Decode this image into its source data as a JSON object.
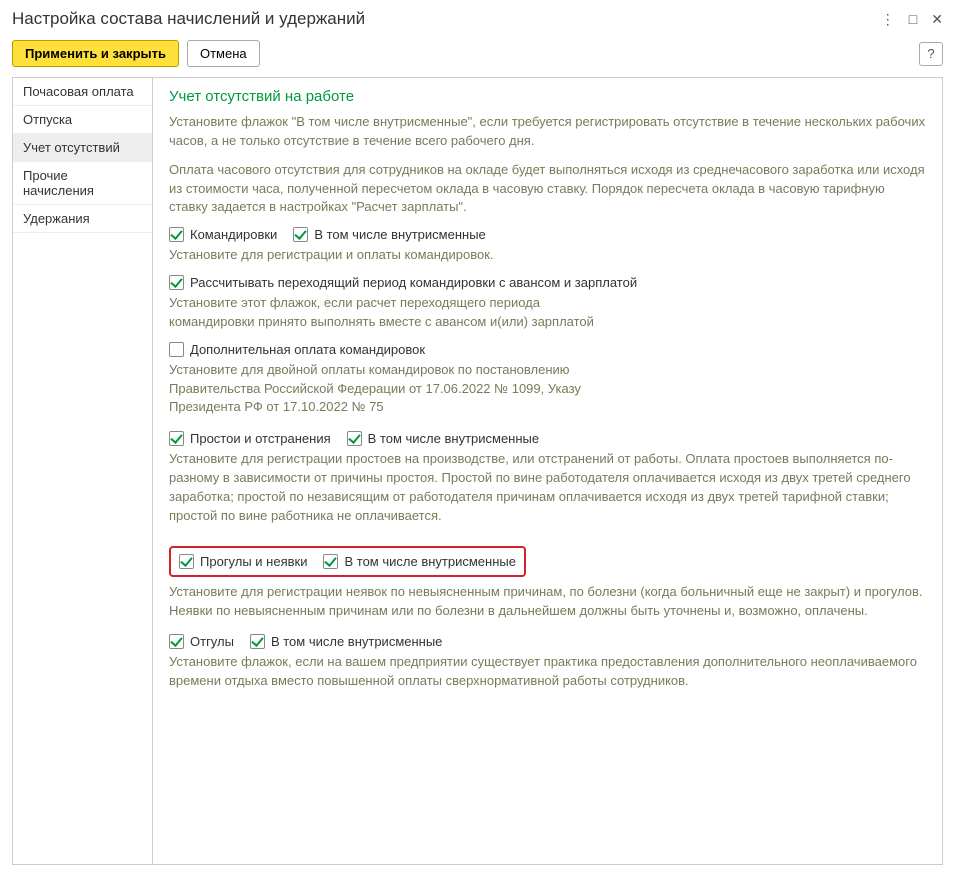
{
  "window": {
    "title": "Настройка состава начислений и удержаний"
  },
  "toolbar": {
    "apply_close": "Применить и закрыть",
    "cancel": "Отмена",
    "help": "?"
  },
  "sidebar": {
    "items": [
      {
        "label": "Почасовая оплата",
        "active": false
      },
      {
        "label": "Отпуска",
        "active": false
      },
      {
        "label": "Учет отсутствий",
        "active": true
      },
      {
        "label": "Прочие начисления",
        "active": false
      },
      {
        "label": "Удержания",
        "active": false
      }
    ]
  },
  "content": {
    "heading": "Учет отсутствий на работе",
    "intro1": "Установите флажок \"В том числе внутрисменные\", если требуется регистрировать отсутствие в течение нескольких рабочих часов, а не только отсутствие в течение всего рабочего дня.",
    "intro2": "Оплата часового отсутствия для сотрудников на окладе будет выполняться исходя из среднечасового заработка или исходя из стоимости часа, полученной пересчетом оклада в часовую ставку. Порядок пересчета оклада в часовую тарифную ставку задается в настройках \"Расчет зарплаты\".",
    "trips": {
      "label": "Командировки",
      "intra": "В том числе внутрисменные",
      "desc": "Установите для регистрации и оплаты командировок."
    },
    "tripsPeriod": {
      "label": "Рассчитывать переходящий период командировки с авансом и зарплатой",
      "desc": "Установите этот флажок, если расчет переходящего периода командировки принято выполнять вместе с авансом и(или) зарплатой"
    },
    "tripsExtra": {
      "label": "Дополнительная оплата командировок",
      "desc": "Установите для двойной оплаты командировок по постановлению Правительства Российской Федерации от 17.06.2022 № 1099, Указу Президента РФ от 17.10.2022 № 75"
    },
    "downtime": {
      "label": "Простои и отстранения",
      "intra": "В том числе внутрисменные",
      "desc": "Установите для регистрации простоев на производстве, или отстранений от работы. Оплата простоев выполняется по-разному в зависимости от причины простоя. Простой по вине работодателя оплачивается исходя из двух третей среднего заработка; простой по независящим от работодателя причинам оплачивается исходя из двух третей тарифной ставки; простой по вине работника не оплачивается."
    },
    "absences": {
      "label": "Прогулы и неявки",
      "intra": "В том числе внутрисменные",
      "desc": "Установите для регистрации неявок по невыясненным причинам, по болезни (когда больничный еще не закрыт) и прогулов. Неявки по невыясненным причинам или по болезни в дальнейшем должны быть уточнены и, возможно, оплачены."
    },
    "comp": {
      "label": "Отгулы",
      "intra": "В том числе внутрисменные",
      "desc": "Установите флажок, если на вашем предприятии существует практика предоставления дополнительного неоплачиваемого времени отдыха вместо повышенной оплаты сверхнормативной работы сотрудников."
    }
  }
}
